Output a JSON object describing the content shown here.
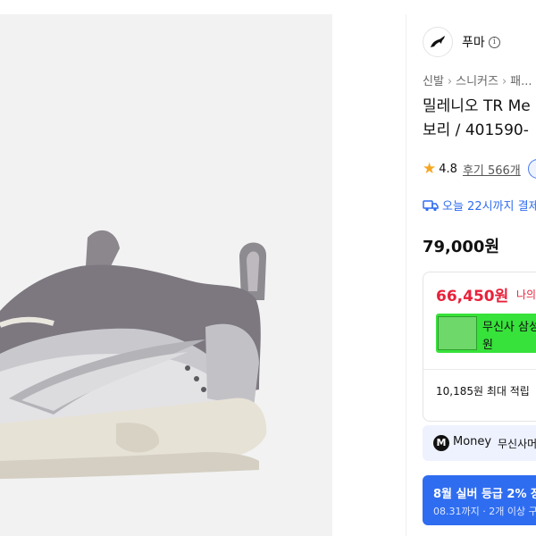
{
  "product_image": {
    "alt": "grey silver sneaker"
  },
  "brand": {
    "name": "푸마",
    "logo_icon": "puma-logo-icon",
    "info_icon": "info-icon"
  },
  "breadcrumb": [
    "신발",
    "스니커즈",
    "패..."
  ],
  "product": {
    "title_line1": "밀레니오 TR Me",
    "title_line2": "보리 / 401590-"
  },
  "rating": {
    "value": "4.8",
    "reviews_label": "후기 566개"
  },
  "delivery": {
    "text": "오늘 22시까지 결제"
  },
  "price": {
    "original": "79,000원"
  },
  "benefit": {
    "sale_price": "66,450원",
    "my_price_label": "나의",
    "card_line1": "무신사 삼성",
    "card_line2": "원",
    "points": "10,185원 최대 적립"
  },
  "money": {
    "brand": "Money",
    "desc": "무신사머"
  },
  "promo": {
    "title": "8월 실버 등급 2% 장",
    "sub": "08.31까지 · 2개 이상 구"
  },
  "colors": {
    "accent_blue": "#2f6df0",
    "sale_red": "#e8213b",
    "card_green": "#37e23a",
    "star": "#f5a623"
  }
}
